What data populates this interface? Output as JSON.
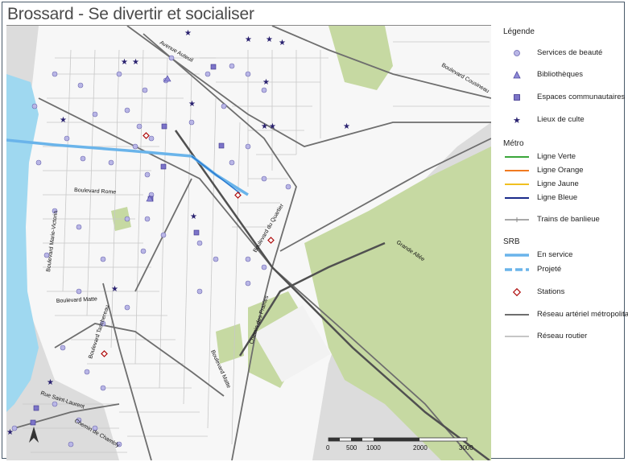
{
  "title": "Brossard - Se divertir et socialiser",
  "legend": {
    "heading": "Légende",
    "poi": [
      {
        "label": "Services de beauté",
        "icon": "circle-icon",
        "color": "#b9b6e6"
      },
      {
        "label": "Bibliothèques",
        "icon": "triangle-icon",
        "color": "#8f8ad6"
      },
      {
        "label": "Espaces communautaires",
        "icon": "square-icon",
        "color": "#7c74c8"
      },
      {
        "label": "Lieux de culte",
        "icon": "star-icon",
        "color": "#2a2270"
      }
    ],
    "metro_heading": "Métro",
    "metro": [
      {
        "label": "Ligne Verte",
        "color": "#3aa63a"
      },
      {
        "label": "Ligne Orange",
        "color": "#f07a20"
      },
      {
        "label": "Ligne Jaune",
        "color": "#f0c020"
      },
      {
        "label": "Ligne Bleue",
        "color": "#1a2a8a"
      },
      {
        "label": "Trains de banlieue",
        "color": "#8c8c8c"
      }
    ],
    "srb_heading": "SRB",
    "srb": [
      {
        "label": "En service",
        "color": "#6ab4ea"
      },
      {
        "label": "Projeté",
        "color": "#6ab4ea"
      },
      {
        "label": "Stations",
        "color": "#b01010"
      },
      {
        "label": "Réseau artériel métropolitain",
        "color": "#6e6e6e"
      },
      {
        "label": "Réseau routier",
        "color": "#b4b4b4"
      }
    ]
  },
  "map": {
    "streets": [
      "Avenue Auteuil",
      "Boulevard Rome",
      "Boulevard Marie-Victorin",
      "Boulevard du Quartier",
      "Boulevard Matte",
      "Boulevard Taschereau",
      "Chemin des Prairies",
      "Boulevard Matte",
      "Grande Allée",
      "Boulevard Cousineau",
      "Rue Saint-Laurent",
      "Chemin de Chambly"
    ],
    "scale_labels": [
      "0",
      "500",
      "1000",
      "2000",
      "3000"
    ]
  }
}
